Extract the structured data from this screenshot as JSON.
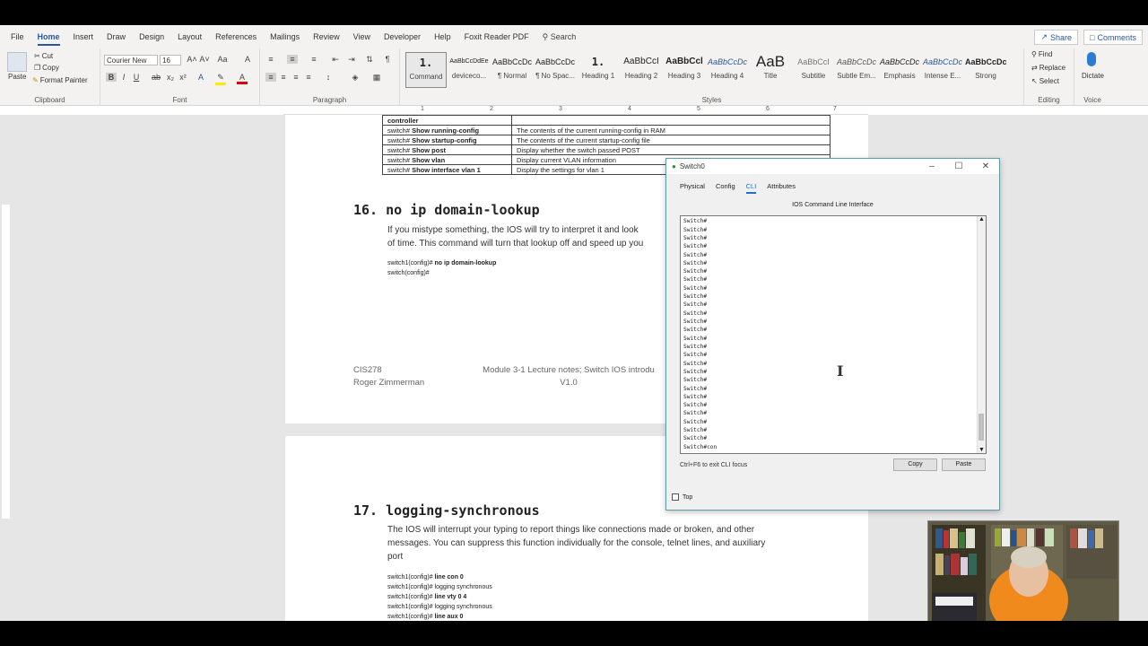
{
  "menubar": {
    "items": [
      "File",
      "Home",
      "Insert",
      "Draw",
      "Design",
      "Layout",
      "References",
      "Mailings",
      "Review",
      "View",
      "Developer",
      "Help",
      "Foxit Reader PDF"
    ],
    "search": "Search",
    "share": "Share",
    "comments": "Comments"
  },
  "ribbon": {
    "clipboard": {
      "paste": "Paste",
      "cut": "Cut",
      "copy": "Copy",
      "format_painter": "Format Painter",
      "label": "Clipboard"
    },
    "font": {
      "name": "Courier New",
      "size": "16",
      "label": "Font"
    },
    "paragraph": {
      "label": "Paragraph"
    },
    "styles": {
      "label": "Styles",
      "items": [
        {
          "sample": "1.",
          "name": "Command"
        },
        {
          "sample": "AaBbCcDdEe",
          "name": "deviceco..."
        },
        {
          "sample": "AaBbCcDc",
          "name": "¶ Normal"
        },
        {
          "sample": "AaBbCcDc",
          "name": "¶ No Spac..."
        },
        {
          "sample": "1.",
          "name": "Heading 1"
        },
        {
          "sample": "AaBbCcI",
          "name": "Heading 2"
        },
        {
          "sample": "AaBbCcl",
          "name": "Heading 3"
        },
        {
          "sample": "AaBbCcDc",
          "name": "Heading 4"
        },
        {
          "sample": "AaB",
          "name": "Title"
        },
        {
          "sample": "AaBbCcI",
          "name": "Subtitle"
        },
        {
          "sample": "AaBbCcDc",
          "name": "Subtle Em..."
        },
        {
          "sample": "AaBbCcDc",
          "name": "Emphasis"
        },
        {
          "sample": "AaBbCcDc",
          "name": "Intense E..."
        },
        {
          "sample": "AaBbCcDc",
          "name": "Strong"
        }
      ]
    },
    "editing": {
      "find": "Find",
      "replace": "Replace",
      "select": "Select",
      "label": "Editing"
    },
    "voice": {
      "dictate": "Dictate",
      "label": "Voice"
    }
  },
  "ruler": {
    "numbers": [
      "1",
      "2",
      "3",
      "4",
      "5",
      "6",
      "7"
    ]
  },
  "document": {
    "table": [
      {
        "cmd": "controller",
        "desc": "",
        "prefix": ""
      },
      {
        "prefix": "switch# ",
        "cmd": "Show running-config",
        "desc": "The contents of the current running-config in RAM"
      },
      {
        "prefix": "switch# ",
        "cmd": "Show startup-config",
        "desc": "The contents of the current startup-config file"
      },
      {
        "prefix": "switch# ",
        "cmd": "Show post",
        "desc": "Display whether the switch passed POST"
      },
      {
        "prefix": "switch# ",
        "cmd": "Show vlan",
        "desc": "Display current VLAN information"
      },
      {
        "prefix": "switch# ",
        "cmd": "Show interface vlan 1",
        "desc": "Display the settings for vlan 1"
      }
    ],
    "section16": {
      "heading": "16. no ip domain-lookup",
      "para_line1": "If you mistype something, the IOS will try to interpret it and look",
      "para_line2": "of time. This command will turn that lookup off and speed up you",
      "code1_prefix": "switch1(config)# ",
      "code1_cmd": "no ip domain-lookup",
      "code2": "switch(config)#"
    },
    "footer": {
      "course": "CIS278",
      "author": "Roger Zimmerman",
      "module": "Module 3-1 Lecture notes; Switch IOS introdu",
      "version": "V1.0"
    },
    "section17": {
      "heading": "17. logging-synchronous",
      "para_line1": "The IOS will interrupt your typing to report things like connections made or broken, and other",
      "para_line2": "messages. You can suppress this function individually for the console, telnet lines, and auxiliary",
      "para_line3": "port",
      "code": [
        {
          "prefix": "switch1(config)# ",
          "cmd": "line con 0"
        },
        {
          "prefix": "switch1(config)# logging synchronous",
          "cmd": ""
        },
        {
          "prefix": "switch1(config)# ",
          "cmd": "line vty 0 4"
        },
        {
          "prefix": "switch1(config)# logging synchronous",
          "cmd": ""
        },
        {
          "prefix": "switch1(config)# ",
          "cmd": "line aux 0"
        }
      ]
    }
  },
  "dialog": {
    "title": "Switch0",
    "tabs": [
      "Physical",
      "Config",
      "CLI",
      "Attributes"
    ],
    "cli_title": "IOS Command Line Interface",
    "cli_lines": [
      "Switch#",
      "Switch#",
      "Switch#",
      "Switch#",
      "Switch#",
      "Switch#",
      "Switch#",
      "Switch#",
      "Switch#",
      "Switch#",
      "Switch#",
      "Switch#",
      "Switch#",
      "Switch#",
      "Switch#",
      "Switch#",
      "Switch#",
      "Switch#",
      "Switch#",
      "Switch#",
      "Switch#",
      "Switch#",
      "Switch#",
      "Switch#",
      "Switch#",
      "Switch#",
      "Switch#",
      "Switch#con"
    ],
    "hint": "Ctrl+F6 to exit CLI focus",
    "copy": "Copy",
    "paste": "Paste",
    "top": "Top"
  }
}
